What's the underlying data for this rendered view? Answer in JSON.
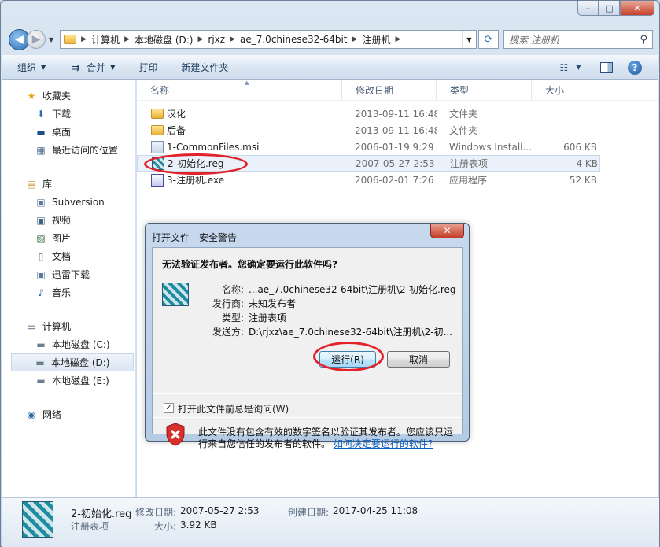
{
  "window": {
    "caption": {
      "min": "–",
      "max": "□",
      "close": "✕"
    }
  },
  "nav": {
    "back": "◀",
    "forward": "▶",
    "crumbs": [
      "计算机",
      "本地磁盘 (D:)",
      "rjxz",
      "ae_7.0chinese32-64bit",
      "注册机"
    ],
    "search_placeholder": "搜索 注册机"
  },
  "toolbar": {
    "organize": "组织",
    "include": "合并",
    "print": "打印",
    "new_folder": "新建文件夹"
  },
  "sidebar": {
    "favorites": "收藏夹",
    "fav_items": [
      "下载",
      "桌面",
      "最近访问的位置"
    ],
    "libraries": "库",
    "lib_items": [
      "Subversion",
      "视频",
      "图片",
      "文档",
      "迅雷下载",
      "音乐"
    ],
    "computer": "计算机",
    "drives": [
      "本地磁盘 (C:)",
      "本地磁盘 (D:)",
      "本地磁盘 (E:)"
    ],
    "network": "网络"
  },
  "columns": {
    "name": "名称",
    "date": "修改日期",
    "type": "类型",
    "size": "大小"
  },
  "files": [
    {
      "name": "汉化",
      "date": "2013-09-11 16:48",
      "type": "文件夹",
      "size": ""
    },
    {
      "name": "后备",
      "date": "2013-09-11 16:48",
      "type": "文件夹",
      "size": ""
    },
    {
      "name": "1-CommonFiles.msi",
      "date": "2006-01-19 9:29",
      "type": "Windows Install...",
      "size": "606 KB"
    },
    {
      "name": "2-初始化.reg",
      "date": "2007-05-27 2:53",
      "type": "注册表项",
      "size": "4 KB"
    },
    {
      "name": "3-注册机.exe",
      "date": "2006-02-01 7:26",
      "type": "应用程序",
      "size": "52 KB"
    }
  ],
  "details": {
    "filename": "2-初始化.reg",
    "filetype": "注册表项",
    "modified_label": "修改日期:",
    "modified": "2007-05-27 2:53",
    "created_label": "创建日期:",
    "created": "2017-04-25 11:08",
    "size_label": "大小:",
    "size": "3.92 KB"
  },
  "dialog": {
    "title": "打开文件 - 安全警告",
    "heading": "无法验证发布者。您确定要运行此软件吗?",
    "props": [
      {
        "label": "名称:",
        "value": "...ae_7.0chinese32-64bit\\注册机\\2-初始化.reg"
      },
      {
        "label": "发行商:",
        "value": "未知发布者"
      },
      {
        "label": "类型:",
        "value": "注册表项"
      },
      {
        "label": "发送方:",
        "value": "D:\\rjxz\\ae_7.0chinese32-64bit\\注册机\\2-初..."
      }
    ],
    "run": "运行(R)",
    "cancel": "取消",
    "always_ask": "打开此文件前总是询问(W)",
    "warning": "此文件没有包含有效的数字签名以验证其发布者。您应该只运行来自您信任的发布者的软件。",
    "link": "如何决定要运行的软件?"
  },
  "colors": {
    "highlight_ring": "#e2212b",
    "link": "#0b5fbf"
  }
}
